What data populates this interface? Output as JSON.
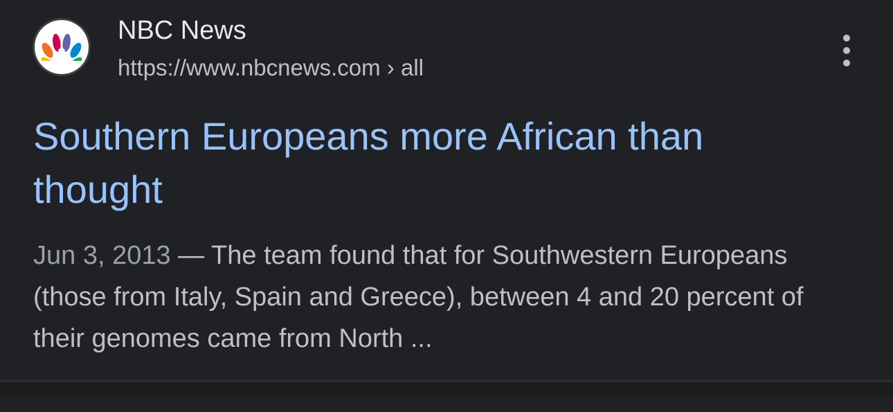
{
  "source": {
    "name": "NBC News",
    "url": "https://www.nbcnews.com › all",
    "icon": "nbc-peacock-logo",
    "more_icon": "more-vert-icon"
  },
  "result": {
    "title": "Southern Europeans more African than thought",
    "date": "Jun 3, 2013",
    "separator": " — ",
    "snippet": "The team found that for Southwestern Europeans (those from Italy, Spain and Greece), between 4 and 20 percent of their genomes came from North ..."
  },
  "colors": {
    "background": "#202124",
    "title_link": "#99c3ff",
    "source_name": "#e8eaed",
    "secondary_text": "#bdc1c6",
    "date_text": "#9aa0a6"
  }
}
